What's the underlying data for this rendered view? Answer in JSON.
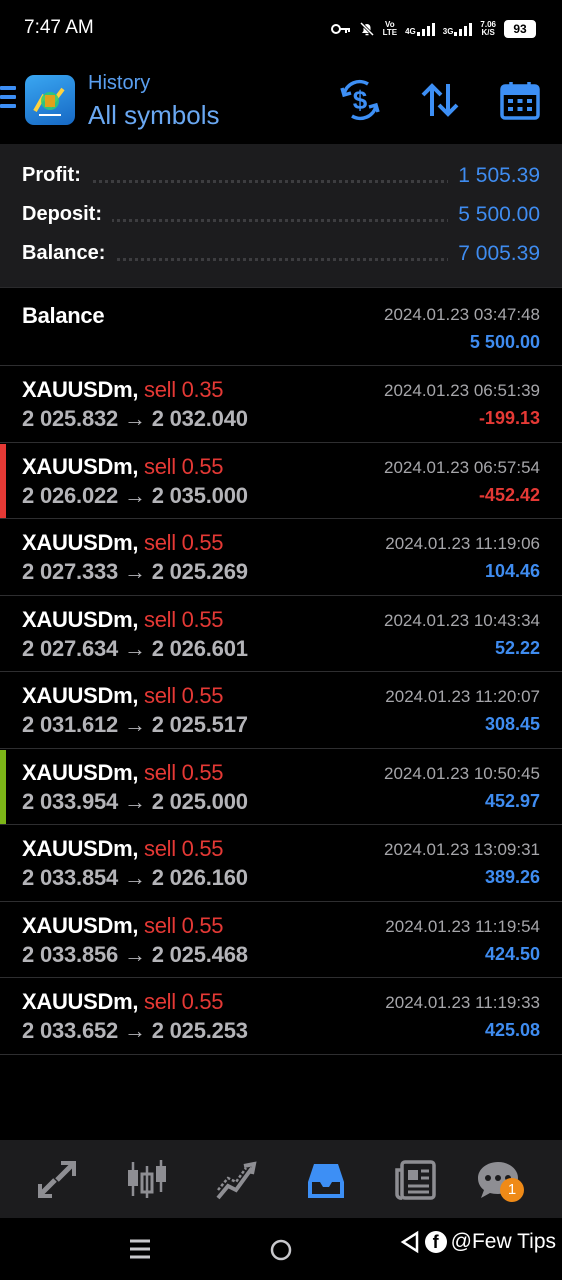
{
  "status_bar": {
    "time": "7:47 AM",
    "volte": "Vo",
    "lte": "LTE",
    "net1": "4G",
    "net2": "3G",
    "speed_value": "7.06",
    "speed_unit": "K/S",
    "battery": "93"
  },
  "header": {
    "subtitle": "History",
    "title": "All symbols"
  },
  "summary": {
    "profit_label": "Profit:",
    "profit_value": "1 505.39",
    "deposit_label": "Deposit:",
    "deposit_value": "5 500.00",
    "balance_label": "Balance:",
    "balance_value": "7 005.39"
  },
  "balance_entry": {
    "label": "Balance",
    "time": "2024.01.23 03:47:48",
    "amount": "5 500.00"
  },
  "trades": [
    {
      "symbol": "XAUUSDm,",
      "side": "sell 0.35",
      "prices": "2 025.832 → 2 032.040",
      "time": "2024.01.23 06:51:39",
      "profit": "-199.13"
    },
    {
      "symbol": "XAUUSDm,",
      "side": "sell 0.55",
      "prices": "2 026.022 → 2 035.000",
      "time": "2024.01.23 06:57:54",
      "profit": "-452.42"
    },
    {
      "symbol": "XAUUSDm,",
      "side": "sell 0.55",
      "prices": "2 027.333 → 2 025.269",
      "time": "2024.01.23 11:19:06",
      "profit": "104.46"
    },
    {
      "symbol": "XAUUSDm,",
      "side": "sell 0.55",
      "prices": "2 027.634 → 2 026.601",
      "time": "2024.01.23 10:43:34",
      "profit": "52.22"
    },
    {
      "symbol": "XAUUSDm,",
      "side": "sell 0.55",
      "prices": "2 031.612 → 2 025.517",
      "time": "2024.01.23 11:20:07",
      "profit": "308.45"
    },
    {
      "symbol": "XAUUSDm,",
      "side": "sell 0.55",
      "prices": "2 033.954 → 2 025.000",
      "time": "2024.01.23 10:50:45",
      "profit": "452.97"
    },
    {
      "symbol": "XAUUSDm,",
      "side": "sell 0.55",
      "prices": "2 033.854 → 2 026.160",
      "time": "2024.01.23 13:09:31",
      "profit": "389.26"
    },
    {
      "symbol": "XAUUSDm,",
      "side": "sell 0.55",
      "prices": "2 033.856 → 2 025.468",
      "time": "2024.01.23 11:19:54",
      "profit": "424.50"
    },
    {
      "symbol": "XAUUSDm,",
      "side": "sell 0.55",
      "prices": "2 033.652 → 2 025.253",
      "time": "2024.01.23 11:19:33",
      "profit": "425.08"
    }
  ],
  "bottom_nav": {
    "items": [
      "quotes-icon",
      "chart-icon",
      "trade-icon",
      "history-icon",
      "news-icon",
      "messages-icon"
    ],
    "messages_badge": "1"
  },
  "watermark": {
    "text": "@Few Tips"
  },
  "colors": {
    "accent": "#3f8cf0",
    "loss": "#e53935",
    "summary_bg": "#1c1c1e",
    "loss_marker": "#e53935",
    "profit_marker": "#7cb518"
  }
}
